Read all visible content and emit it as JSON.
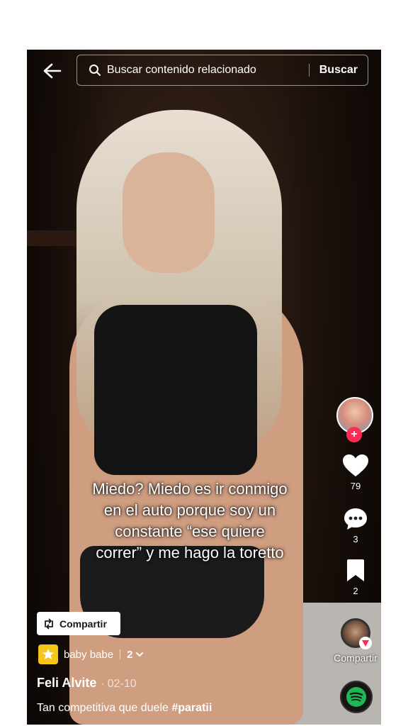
{
  "topbar": {
    "search_placeholder": "Buscar contenido relacionado",
    "search_button": "Buscar"
  },
  "video": {
    "caption_lines": [
      "Miedo? Miedo es ir conmigo",
      "en el auto porque soy un",
      "constante “ese quiere",
      "correr” y me hago la toretto"
    ]
  },
  "rail": {
    "likes": "79",
    "comments": "3",
    "saves": "2",
    "share_label": "Compartir"
  },
  "overlay": {
    "share_chip_label": "Compartir",
    "playlist_name": "baby babe",
    "playlist_count": "2",
    "author": "Feli Alvite",
    "date_sep": "·",
    "date": "02-10",
    "description": "Tan competitiva que duele ",
    "hashtag": "#paratii"
  },
  "colors": {
    "accent": "#fe2c55",
    "spotify": "#1db954",
    "playlist": "#f5c518"
  },
  "icons": [
    "back-arrow-icon",
    "search-icon",
    "heart-icon",
    "comment-icon",
    "bookmark-icon",
    "share-icon",
    "spotify-icon",
    "repost-icon",
    "playlist-icon",
    "chevron-down-icon"
  ]
}
